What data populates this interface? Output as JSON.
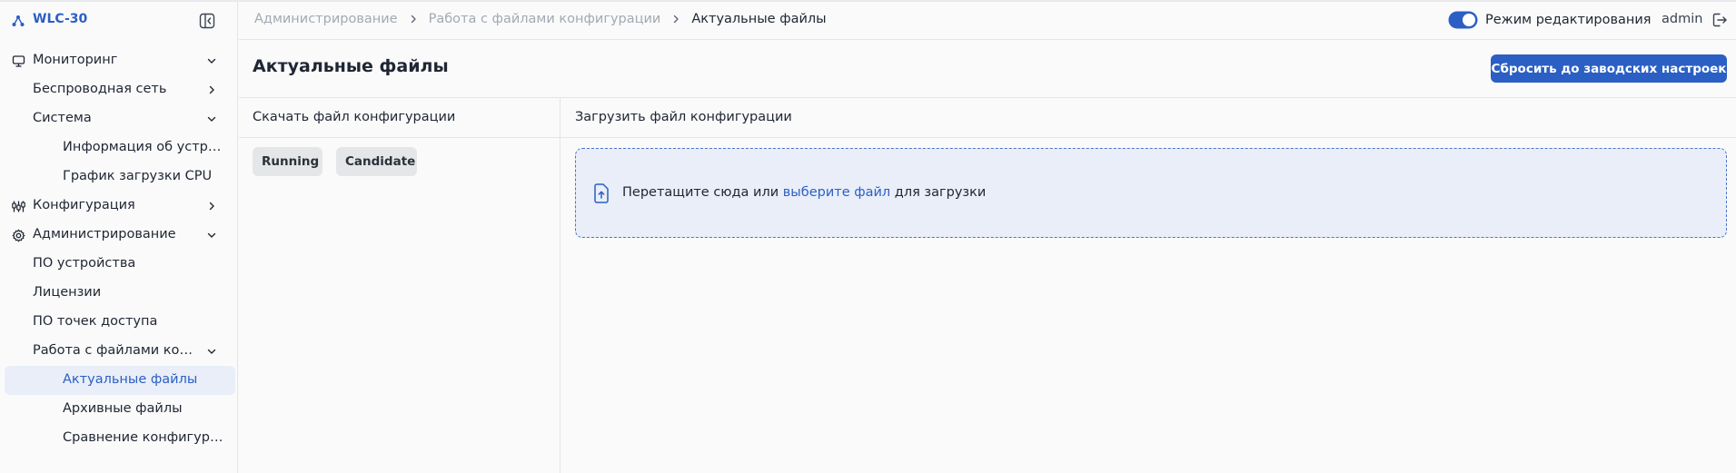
{
  "brand": {
    "name": "WLC-30"
  },
  "colors": {
    "accent": "#2b5fc4",
    "active_bg": "#e9eef8",
    "chip_bg": "#e5e6e8"
  },
  "sidebar": {
    "items": [
      {
        "label": "Мониторинг",
        "icon": "monitor-icon",
        "chevron": "down"
      },
      {
        "label": "Беспроводная сеть",
        "chevron": "right"
      },
      {
        "label": "Система",
        "chevron": "down"
      },
      {
        "label": "Информация об устройс..."
      },
      {
        "label": "График загрузки CPU"
      },
      {
        "label": "Конфигурация",
        "icon": "sliders-icon",
        "chevron": "right"
      },
      {
        "label": "Администрирование",
        "icon": "gear-icon",
        "chevron": "down"
      },
      {
        "label": "ПО устройства"
      },
      {
        "label": "Лицензии"
      },
      {
        "label": "ПО точек доступа"
      },
      {
        "label": "Работа с файлами конф...",
        "chevron": "down"
      },
      {
        "label": "Актуальные файлы",
        "active": true
      },
      {
        "label": "Архивные файлы"
      },
      {
        "label": "Сравнение конфигураций"
      }
    ]
  },
  "breadcrumb": [
    "Администрирование",
    "Работа с файлами конфигурации",
    "Актуальные файлы"
  ],
  "topbar": {
    "edit_mode_label": "Режим редактирования",
    "edit_mode_on": true,
    "user": "admin"
  },
  "page": {
    "title": "Актуальные файлы",
    "reset_button": "Сбросить до заводских настроек"
  },
  "download": {
    "title": "Скачать файл конфигурации",
    "buttons": [
      "Running",
      "Candidate"
    ]
  },
  "upload": {
    "title": "Загрузить файл конфигурации",
    "text_before": "Перетащите сюда или ",
    "link": "выберите файл",
    "text_after": " для загрузки"
  }
}
